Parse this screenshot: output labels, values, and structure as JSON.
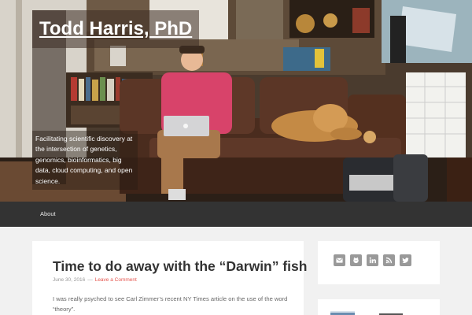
{
  "site": {
    "title": "Todd Harris, PhD",
    "description": "Facilitating scientific discovery at the intersection of genetics, genomics, bioinformatics, big data, cloud computing, and open science."
  },
  "nav": {
    "items": [
      {
        "label": "About"
      }
    ]
  },
  "post": {
    "title": "Time to do away with the “Darwin” fish",
    "date": "June 30, 2016",
    "separator": "—",
    "comment_link": "Leave a Comment",
    "excerpt": "I was really psyched to see Carl Zimmer’s recent NY Times article on the use of the word “theory”."
  },
  "social": {
    "icons": [
      "email-icon",
      "github-icon",
      "linkedin-icon",
      "rss-icon",
      "twitter-icon"
    ],
    "button_color": "#999999"
  },
  "colors": {
    "accent": "#e5554e",
    "nav_bg": "#333333",
    "page_bg": "#f1f1f1"
  }
}
